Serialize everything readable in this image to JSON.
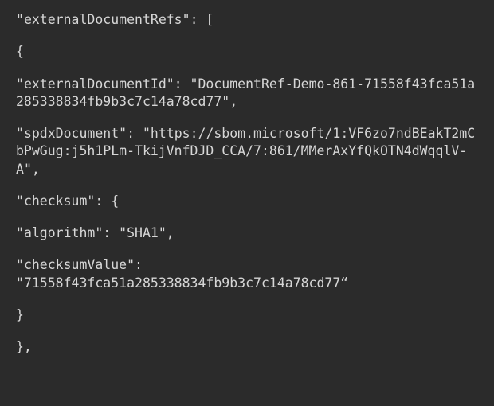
{
  "code": {
    "line1_key": "externalDocumentRefs",
    "line1_after": ": [",
    "line2": "{",
    "extDocId_key": "externalDocumentId",
    "extDocId_val": "DocumentRef-Demo-861-71558f43fca51a285338834fb9b3c7c14a78cd77",
    "spdxDoc_key": "spdxDocument",
    "spdxDoc_val": "https://sbom.microsoft/1:VF6zo7ndBEakT2mCbPwGug:j5h1PLm-TkijVnfDJD_CCA/7:861/MMerAxYfQkOTN4dWqqlV-A",
    "checksum_key": "checksum",
    "checksum_after": ": {",
    "algo_key": "algorithm",
    "algo_val": "SHA1",
    "cval_key": "checksumValue",
    "cval_val": "71558f43fca51a285338834fb9b3c7c14a78cd77",
    "close1": "}",
    "close2": "},"
  }
}
